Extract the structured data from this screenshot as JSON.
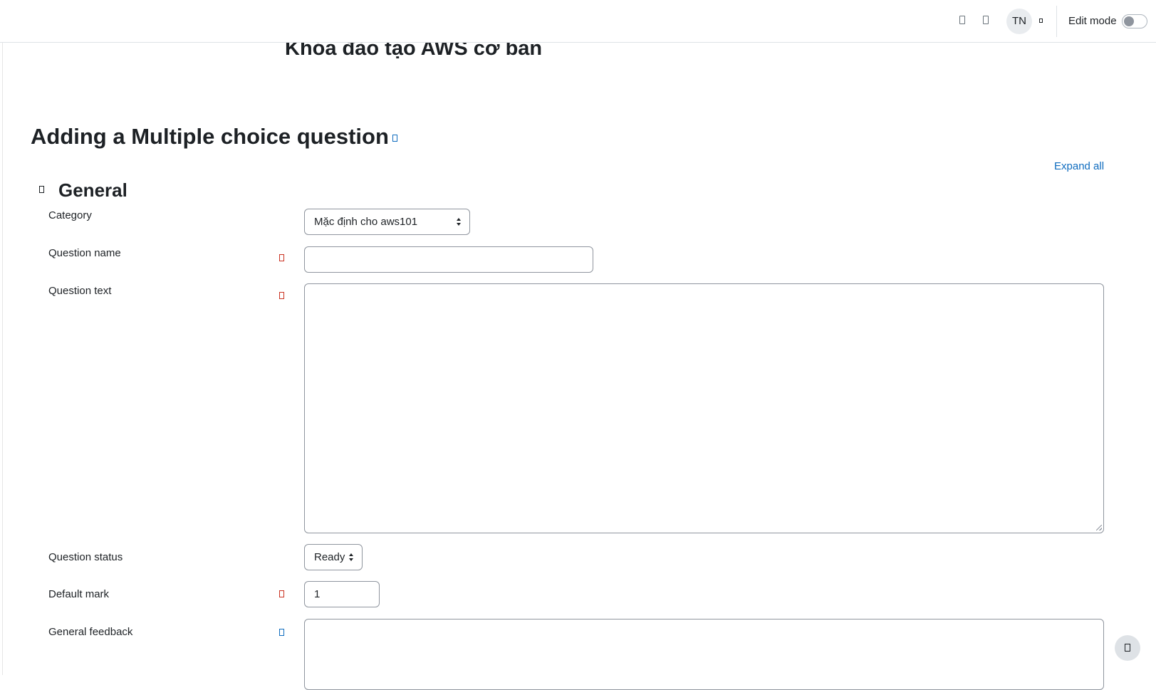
{
  "header": {
    "avatar_initials": "TN",
    "edit_mode_label": "Edit mode",
    "edit_mode_on": false
  },
  "course": {
    "title": "Khóa đào tạo AWS cơ bản"
  },
  "page": {
    "title": "Adding a Multiple choice question",
    "expand_all_label": "Expand all"
  },
  "section": {
    "title": "General"
  },
  "form": {
    "category": {
      "label": "Category",
      "value": "Mặc định cho aws101"
    },
    "question_name": {
      "label": "Question name",
      "value": ""
    },
    "question_text": {
      "label": "Question text",
      "value": ""
    },
    "question_status": {
      "label": "Question status",
      "value": "Ready"
    },
    "default_mark": {
      "label": "Default mark",
      "value": "1"
    },
    "general_feedback": {
      "label": "General feedback",
      "value": ""
    }
  },
  "colors": {
    "link": "#0f6cbf",
    "required": "#ca3120",
    "text": "#1d2125",
    "border": "#8f959e"
  }
}
